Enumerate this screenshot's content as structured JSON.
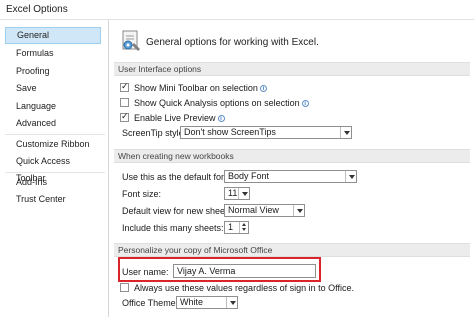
{
  "window": {
    "title": "Excel Options"
  },
  "sidebar": {
    "items": [
      {
        "label": "General"
      },
      {
        "label": "Formulas"
      },
      {
        "label": "Proofing"
      },
      {
        "label": "Save"
      },
      {
        "label": "Language"
      },
      {
        "label": "Advanced"
      },
      {
        "label": "Customize Ribbon"
      },
      {
        "label": "Quick Access Toolbar"
      },
      {
        "label": "Add-Ins"
      },
      {
        "label": "Trust Center"
      }
    ]
  },
  "header": {
    "text": "General options for working with Excel."
  },
  "ui_options": {
    "section_title": "User Interface options",
    "mini_toolbar": {
      "label": "Show Mini Toolbar on selection",
      "checked": true
    },
    "quick_analysis": {
      "label": "Show Quick Analysis options on selection",
      "checked": false
    },
    "live_preview": {
      "label": "Enable Live Preview",
      "checked": true
    },
    "screentip": {
      "label": "ScreenTip style:",
      "value": "Don't show ScreenTips"
    }
  },
  "new_workbooks": {
    "section_title": "When creating new workbooks",
    "font": {
      "label": "Use this as the default font:",
      "value": "Body Font"
    },
    "font_size": {
      "label": "Font size:",
      "value": "11"
    },
    "default_view": {
      "label": "Default view for new sheets:",
      "value": "Normal View"
    },
    "sheets": {
      "label": "Include this many sheets:",
      "value": "1"
    }
  },
  "personalize": {
    "section_title": "Personalize your copy of Microsoft Office",
    "user_name": {
      "label": "User name:",
      "value": "Vijay A. Verma"
    },
    "always_use": {
      "label": "Always use these values regardless of sign in to Office.",
      "checked": false
    },
    "theme": {
      "label": "Office Theme:",
      "value": "White"
    }
  },
  "colors": {
    "highlight": "#d9242b",
    "active_nav": "#cfe7f7"
  }
}
